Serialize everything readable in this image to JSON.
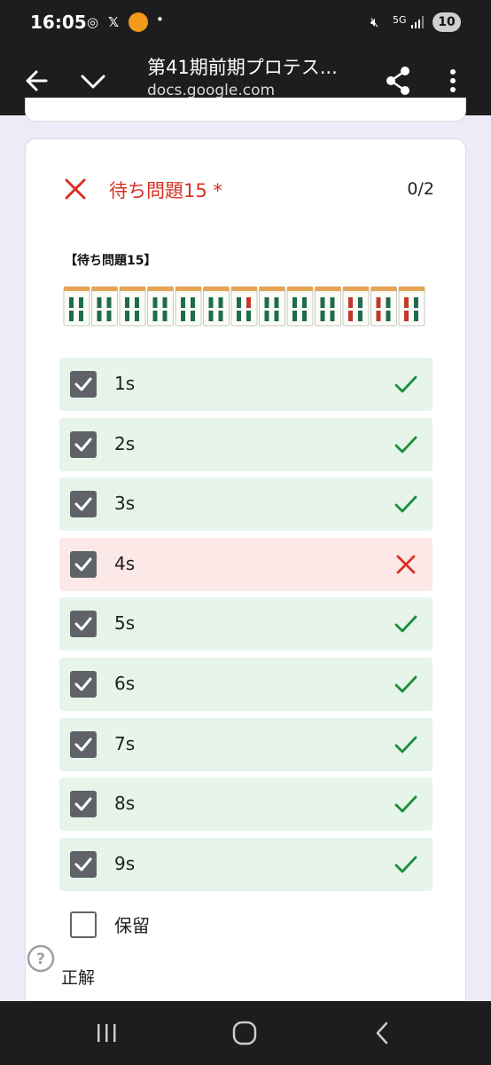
{
  "status_bar": {
    "time": "16:05",
    "icons": [
      "chrome-icon",
      "x-icon",
      "app-icon",
      "dot-icon",
      "mute-icon",
      "5g-icon",
      "signal-icon"
    ],
    "battery": "10"
  },
  "toolbar": {
    "title": "第41期前期プロテス...",
    "url": "docs.google.com"
  },
  "question": {
    "title": "待ち問題15 *",
    "score": "0/2",
    "image_caption": "【待ち問題15】",
    "options": [
      {
        "label": "1s",
        "checked": true,
        "correct": true
      },
      {
        "label": "2s",
        "checked": true,
        "correct": true
      },
      {
        "label": "3s",
        "checked": true,
        "correct": true
      },
      {
        "label": "4s",
        "checked": true,
        "correct": false
      },
      {
        "label": "5s",
        "checked": true,
        "correct": true
      },
      {
        "label": "6s",
        "checked": true,
        "correct": true
      },
      {
        "label": "7s",
        "checked": true,
        "correct": true
      },
      {
        "label": "8s",
        "checked": true,
        "correct": true
      },
      {
        "label": "9s",
        "checked": true,
        "correct": true
      }
    ],
    "pending_option": "保留",
    "answer_label": "正解"
  },
  "colors": {
    "correct_bg": "#e6f4ea",
    "wrong_bg": "#fce8e6",
    "correct_mark": "#1e8e3e",
    "wrong_mark": "#d93025"
  }
}
